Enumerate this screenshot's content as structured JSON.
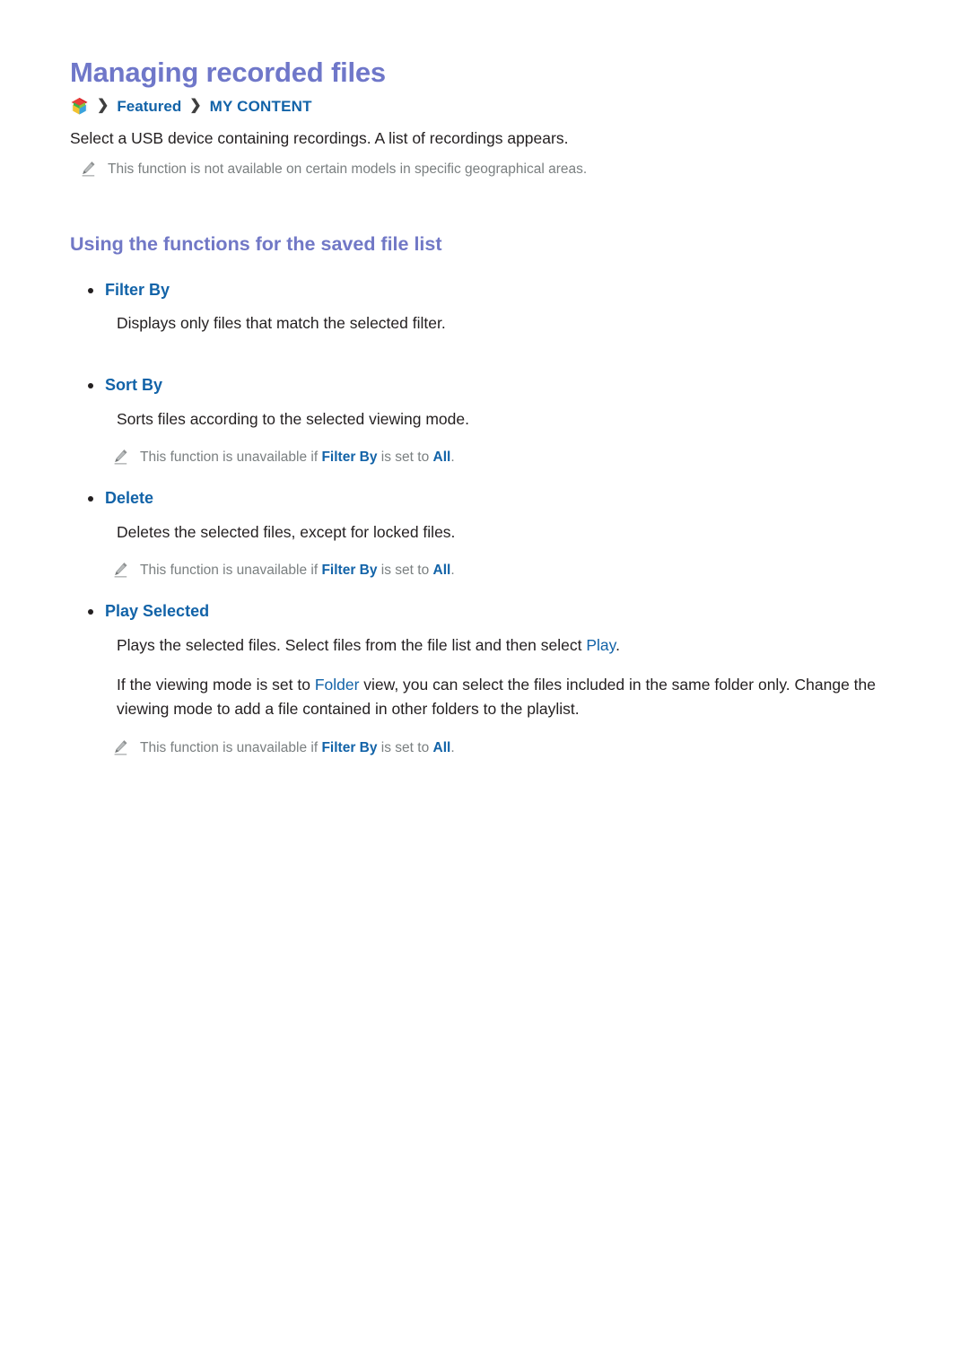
{
  "document": {
    "title": "Managing recorded files",
    "breadcrumb": {
      "icon": "smart-hub-cube-icon",
      "separator": "❯",
      "items": [
        "Featured",
        "MY CONTENT"
      ]
    },
    "intro": "Select a USB device containing recordings. A list of recordings appears.",
    "intro_note": {
      "icon": "pencil-icon",
      "text": "This function is not available on certain models in specific geographical areas."
    },
    "section": {
      "heading": "Using the functions for the saved file list",
      "items": [
        {
          "label": "Filter By",
          "description": "Displays only files that match the selected filter.",
          "notes": []
        },
        {
          "label": "Sort By",
          "description": "Sorts files according to the selected viewing mode.",
          "notes": [
            {
              "icon": "pencil-icon",
              "prefix": "This function is unavailable if ",
              "term1": "Filter By",
              "middle": " is set to ",
              "term2": "All",
              "suffix": "."
            }
          ]
        },
        {
          "label": "Delete",
          "description": "Deletes the selected files, except for locked files.",
          "notes": [
            {
              "icon": "pencil-icon",
              "prefix": "This function is unavailable if ",
              "term1": "Filter By",
              "middle": " is set to ",
              "term2": "All",
              "suffix": "."
            }
          ]
        },
        {
          "label": "Play Selected",
          "description_parts": {
            "before": "Plays the selected files. Select files from the file list and then select ",
            "highlight": "Play",
            "after": "."
          },
          "paragraph_parts": {
            "before": "If the viewing mode is set to ",
            "highlight": "Folder",
            "after": " view, you can select the files included in the same folder only. Change the viewing mode to add a file contained in other folders to the playlist."
          },
          "notes": [
            {
              "icon": "pencil-icon",
              "prefix": "This function is unavailable if ",
              "term1": "Filter By",
              "middle": " is set to ",
              "term2": "All",
              "suffix": "."
            }
          ]
        }
      ]
    }
  },
  "colors": {
    "title": "#6f77c9",
    "heading": "#7178c6",
    "link_blue": "#1263a8",
    "body_text": "#231f20",
    "note_text": "#7a7f80",
    "background": "#ffffff"
  }
}
